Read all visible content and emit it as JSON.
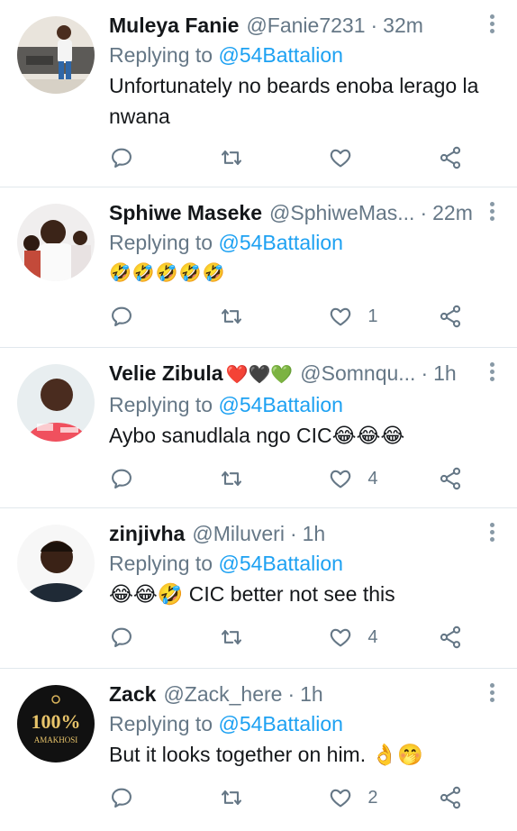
{
  "replying_prefix": "Replying to",
  "mention": "@54Battalion",
  "tweets": [
    {
      "name": "Muleya Fanie",
      "hearts": "",
      "handle": "@Fanie7231",
      "sep": "·",
      "time": "32m",
      "text": "Unfortunately no beards enoba lerago la nwana",
      "likes": ""
    },
    {
      "name": "Sphiwe Maseke",
      "hearts": "",
      "handle": "@SphiweMas...",
      "sep": "·",
      "time": "22m",
      "text": "🤣🤣🤣🤣🤣",
      "likes": "1"
    },
    {
      "name": "Velie Zibula",
      "hearts": "❤️🖤💚",
      "handle": "@Somnqu...",
      "sep": "·",
      "time": "1h",
      "text": "Aybo sanudlala ngo CIC😂😂😂",
      "likes": "4"
    },
    {
      "name": "zinjivha",
      "hearts": "",
      "handle": "@Miluveri",
      "sep": "·",
      "time": "1h",
      "text": "😂😂🤣 CIC better not see this",
      "likes": "4"
    },
    {
      "name": "Zack",
      "hearts": "",
      "handle": "@Zack_here",
      "sep": "·",
      "time": "1h",
      "text": "But it looks together on him. 👌🤭",
      "likes": "2"
    }
  ],
  "avatar_badge": {
    "top": "100%",
    "bottom": "AMAKHOSI"
  },
  "icons": [
    "reply-icon",
    "retweet-icon",
    "like-icon",
    "share-icon",
    "more-options-icon"
  ],
  "colors": {
    "accent": "#1da1f2",
    "secondary_text": "#657786",
    "divider": "#e1e8ed"
  }
}
